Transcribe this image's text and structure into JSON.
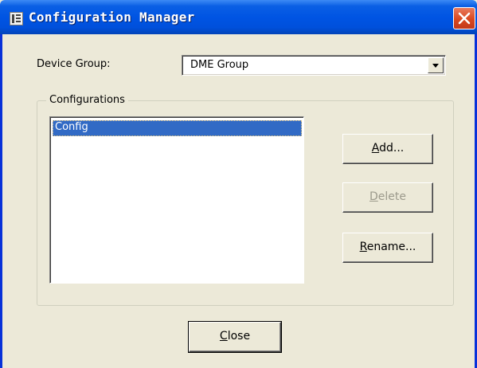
{
  "window": {
    "title": "Configuration Manager",
    "icon": "configuration-manager-app-icon"
  },
  "device_group": {
    "label": "Device Group:",
    "value": "DME Group"
  },
  "configurations": {
    "legend": "Configurations",
    "items": [
      {
        "label": "Config",
        "selected": true
      }
    ]
  },
  "buttons": {
    "add": {
      "access_key": "A",
      "rest": "dd...",
      "enabled": true
    },
    "delete": {
      "access_key": "D",
      "rest": "elete",
      "enabled": false
    },
    "rename": {
      "access_key": "R",
      "rest": "ename...",
      "enabled": true
    },
    "close": {
      "access_key": "C",
      "rest": "lose",
      "enabled": true
    }
  },
  "colors": {
    "titlebar": "#0054e3",
    "selection": "#316ac5",
    "close_button": "#d9481f",
    "dialog_bg": "#ece9d8"
  }
}
